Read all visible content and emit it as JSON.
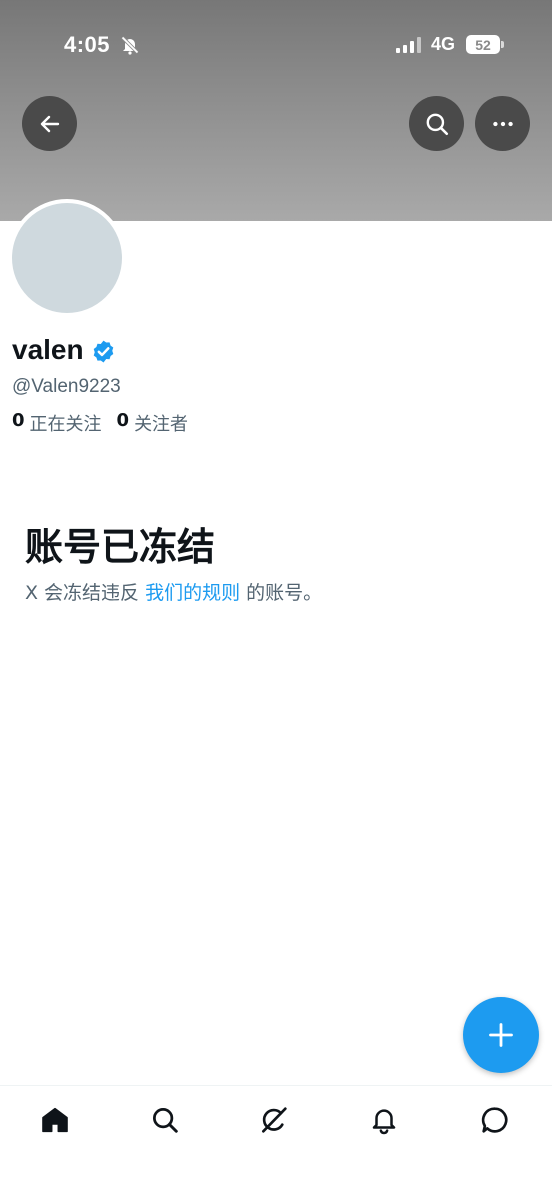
{
  "status_bar": {
    "time": "4:05",
    "network": "4G",
    "battery": "52"
  },
  "header": {
    "icons": [
      "back-arrow-icon",
      "search-icon",
      "more-icon"
    ]
  },
  "profile": {
    "display_name": "valen",
    "verified": true,
    "handle": "@Valen9223",
    "following_count": "0",
    "following_label": "正在关注",
    "followers_count": "0",
    "followers_label": "关注者"
  },
  "notice": {
    "title": "账号已冻结",
    "desc_before": "X 会冻结违反",
    "link_text": "我们的规则",
    "desc_after": "的账号。"
  },
  "fab": {
    "icon": "plus-icon"
  },
  "bottom_nav": {
    "items": [
      "home-icon",
      "search-icon",
      "grok-icon",
      "notifications-icon",
      "messages-icon"
    ]
  },
  "colors": {
    "accent": "#1d9bf0",
    "secondary_text": "#536471",
    "primary_text": "#0f1419",
    "avatar_placeholder": "#cfd9de"
  }
}
